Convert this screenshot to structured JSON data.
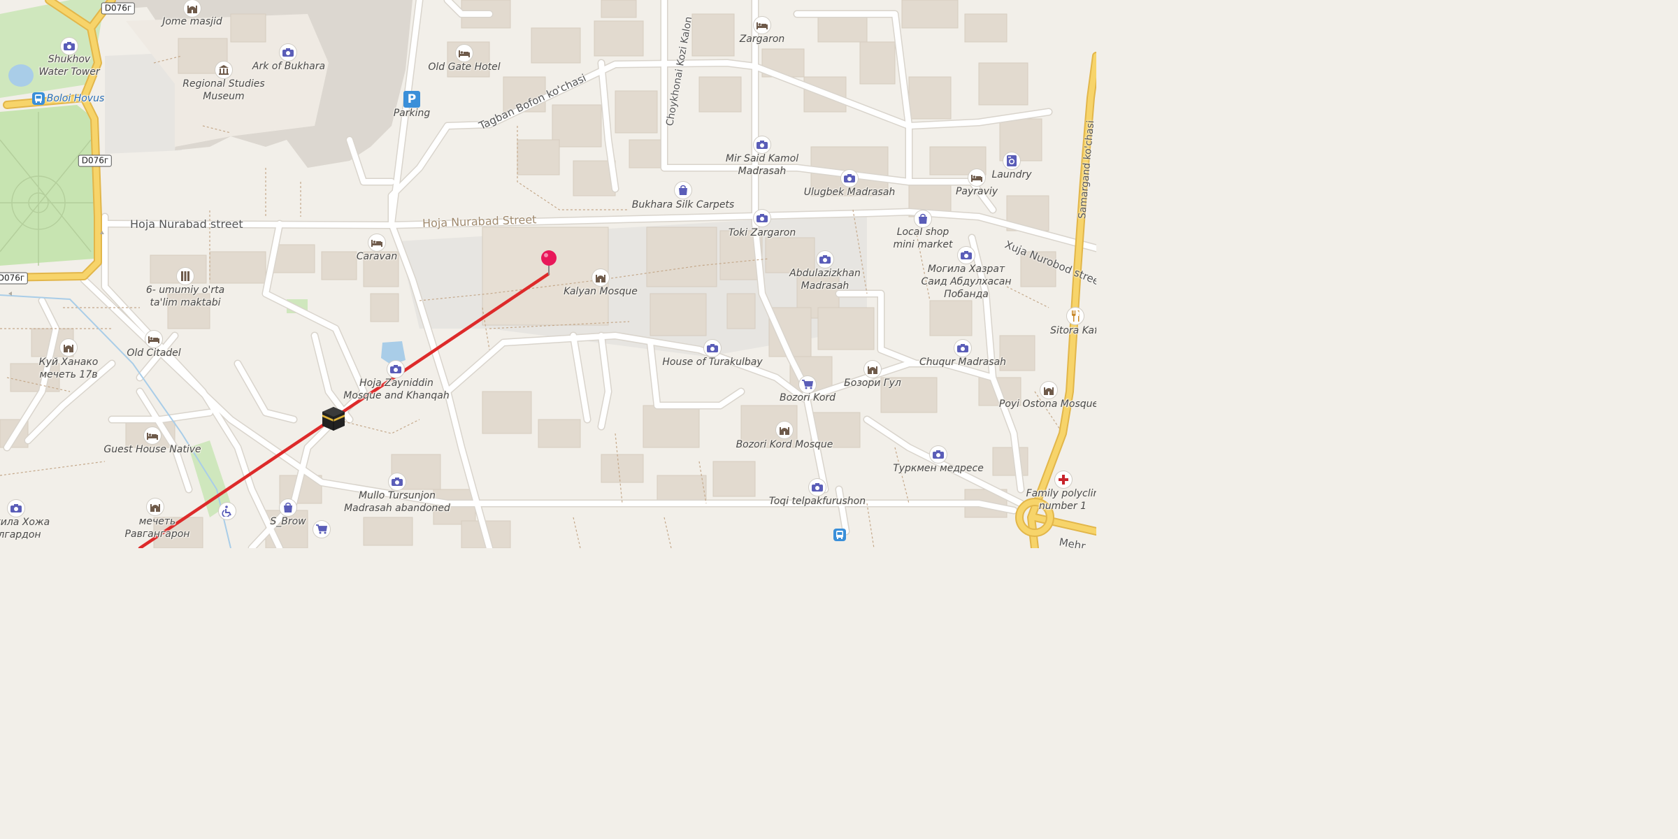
{
  "road_shields": [
    "D076г",
    "D076г",
    "D076г"
  ],
  "streets": {
    "hoja_nurabad_west": "Hoja Nurabad street",
    "hoja_nurabad_east": "Hoja Nurabad Street",
    "tagban": "Tagban Bofon ko'chasi",
    "choykhonai": "Choykhonai Kozi Kalon",
    "samargand": "Samargand ko'chasi",
    "xuja": "Xuja Nurobod street",
    "mehr": "Mehr"
  },
  "places": {
    "jome_masjid": "Jome masjid",
    "shukhov": "Shukhov\nWater Tower",
    "boloi_hovus": "Boloi Hovus",
    "ark": "Ark of Bukhara",
    "regional_museum": "Regional Studies\nMuseum",
    "old_gate_hotel": "Old Gate Hotel",
    "parking": "Parking",
    "zargaron": "Zargaron",
    "mir_said": "Mir Said Kamol\nMadrasah",
    "ulugbek": "Ulugbek Madrasah",
    "laundry": "Laundry",
    "payraviy": "Payraviy",
    "bukhara_silk": "Bukhara Silk Carpets",
    "toki_zargaron": "Toki Zargaron",
    "local_shop": "Local shop\nmini market",
    "caravan": "Caravan",
    "kalyan": "Kalyan Mosque",
    "abdulazizkhan": "Abdulazizkhan\nMadrasah",
    "mogila_said": "Могила Хазрат\nСаид Абдулхасан\nПобанда",
    "sitora": "Sitora Kaf",
    "umumiy": "6- umumiy o'rta\nta'lim maktabi",
    "kuy_hanako": "Куй Ханако\nмечеть 17в",
    "old_citadel": "Old Citadel",
    "hoja_zayniddin": "Hoja Zayniddin\nMosque and Khanqah",
    "house_turakulbay": "House of Turakulbay",
    "chuqur": "Chuqur Madrasah",
    "bozori_gul": "Бозори Гул",
    "bozori_kord": "Bozori Kord",
    "poyi_ostona": "Poyi Ostona Mosque",
    "guest_house": "Guest House Native",
    "bozori_kord_mosque": "Bozori Kord Mosque",
    "turkmen": "Туркмен медресе",
    "family_poly": "Family polyclin\nnumber 1",
    "mullo": "Mullo Tursunjon\nMadrasah abandoned",
    "toqi_telpak": "Toqi telpakfurushon",
    "s_brow": "S_Brow",
    "mogila_hozha": "огила Хожа\nлгардон",
    "mechet_ravgan": "мечеть\nРавгангарон"
  },
  "parking_symbol": "P",
  "colors": {
    "background": "#f2efe9",
    "road": "#ffffff",
    "road_casing": "#d9d4cc",
    "primary_road": "#f7d46a",
    "primary_casing": "#e2b64a",
    "park": "#c8e6b0",
    "water": "#a9cde8",
    "building": "#e3dbd0",
    "square": "#e6e4df",
    "route_line": "#dd2a2a",
    "pin": "#e8185a",
    "poi_icon": "#5a5db8",
    "poi_icon_brown": "#6e5a4a"
  }
}
